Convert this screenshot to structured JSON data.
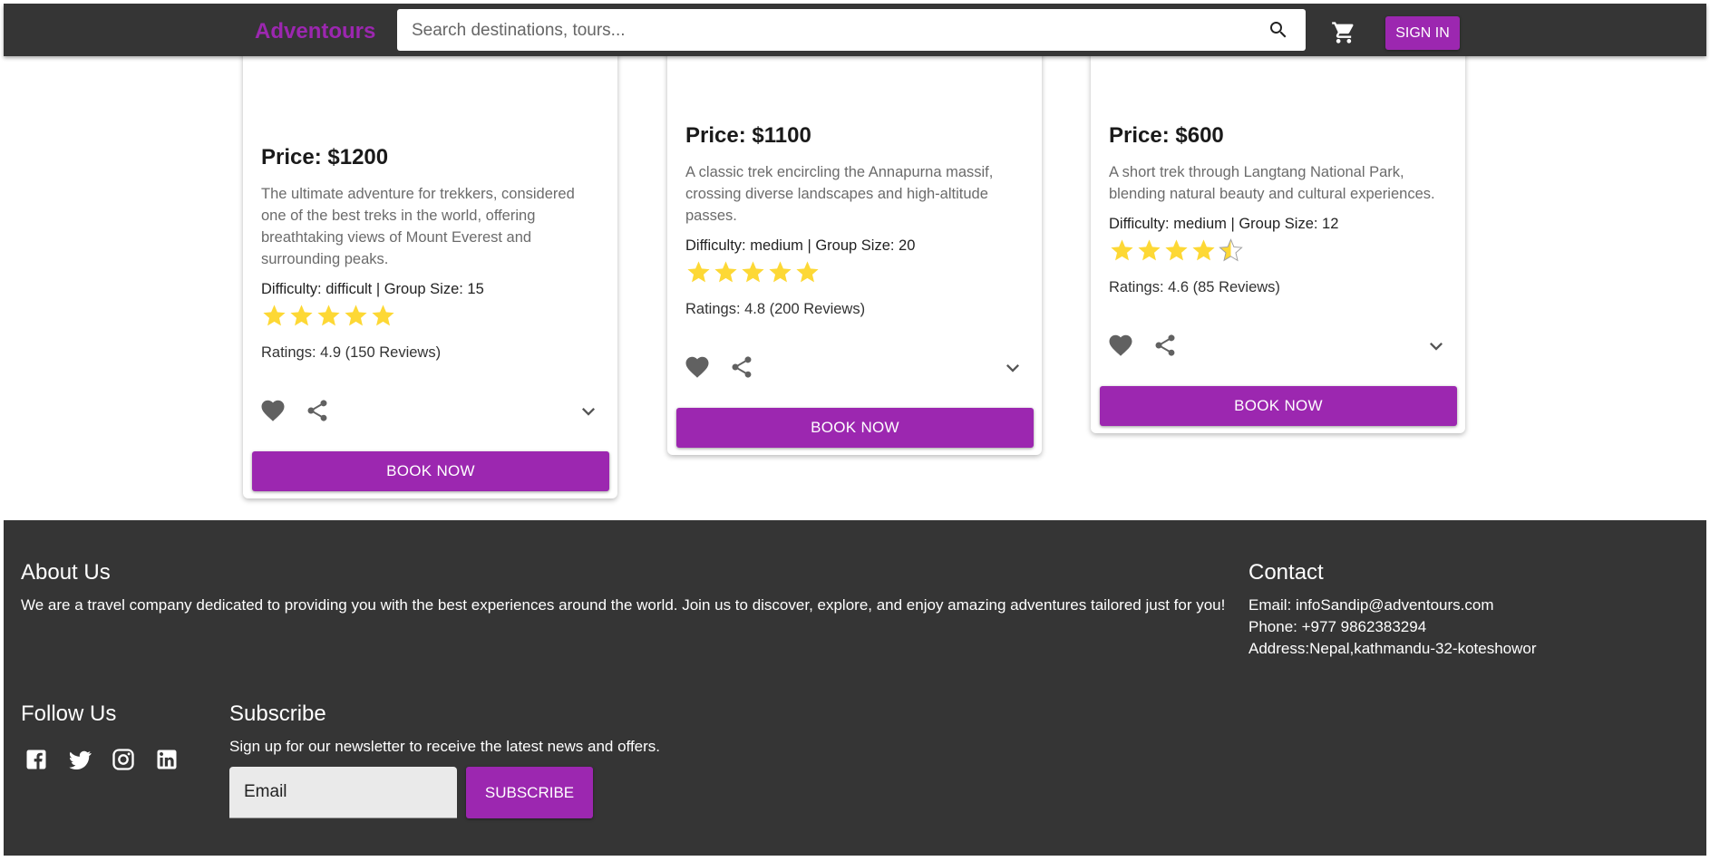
{
  "header": {
    "brand": "Adventours",
    "search_placeholder": "Search destinations, tours...",
    "signin_label": "SIGN IN"
  },
  "tours": [
    {
      "price": "Price: $1200",
      "description": "The ultimate adventure for trekkers, considered one of the best treks in the world, offering breathtaking views of Mount Everest and surrounding peaks.",
      "meta": "Difficulty: difficult | Group Size: 15",
      "rating_value": 4.9,
      "stars_shown": 5,
      "ratings_text": "Ratings: 4.9 (150 Reviews)",
      "book_label": "BOOK NOW"
    },
    {
      "price": "Price: $1100",
      "description": "A classic trek encircling the Annapurna massif, crossing diverse landscapes and high-altitude passes.",
      "meta": "Difficulty: medium | Group Size: 20",
      "rating_value": 4.8,
      "stars_shown": 5,
      "ratings_text": "Ratings: 4.8 (200 Reviews)",
      "book_label": "BOOK NOW"
    },
    {
      "price": "Price: $600",
      "description": "A short trek through Langtang National Park, blending natural beauty and cultural experiences.",
      "meta": "Difficulty: medium | Group Size: 12",
      "rating_value": 4.6,
      "stars_shown": 4.5,
      "ratings_text": "Ratings: 4.6 (85 Reviews)",
      "book_label": "BOOK NOW"
    }
  ],
  "footer": {
    "about_title": "About Us",
    "about_text": "We are a travel company dedicated to providing you with the best experiences around the world. Join us to discover, explore, and enjoy amazing adventures tailored just for you!",
    "contact_title": "Contact",
    "contact_email": "Email: infoSandip@adventours.com",
    "contact_phone": "Phone: +977 9862383294",
    "contact_address": "Address:Nepal,kathmandu-32-koteshowor",
    "follow_title": "Follow Us",
    "social_icons": [
      "facebook-icon",
      "twitter-icon",
      "instagram-icon",
      "linkedin-icon"
    ],
    "subscribe_title": "Subscribe",
    "subscribe_text": "Sign up for our newsletter to receive the latest news and offers.",
    "email_placeholder": "Email",
    "subscribe_label": "SUBSCRIBE"
  },
  "colors": {
    "accent": "#9c27b0",
    "header_bg": "#353535",
    "footer_bg": "#353535",
    "star": "#fdd835"
  }
}
